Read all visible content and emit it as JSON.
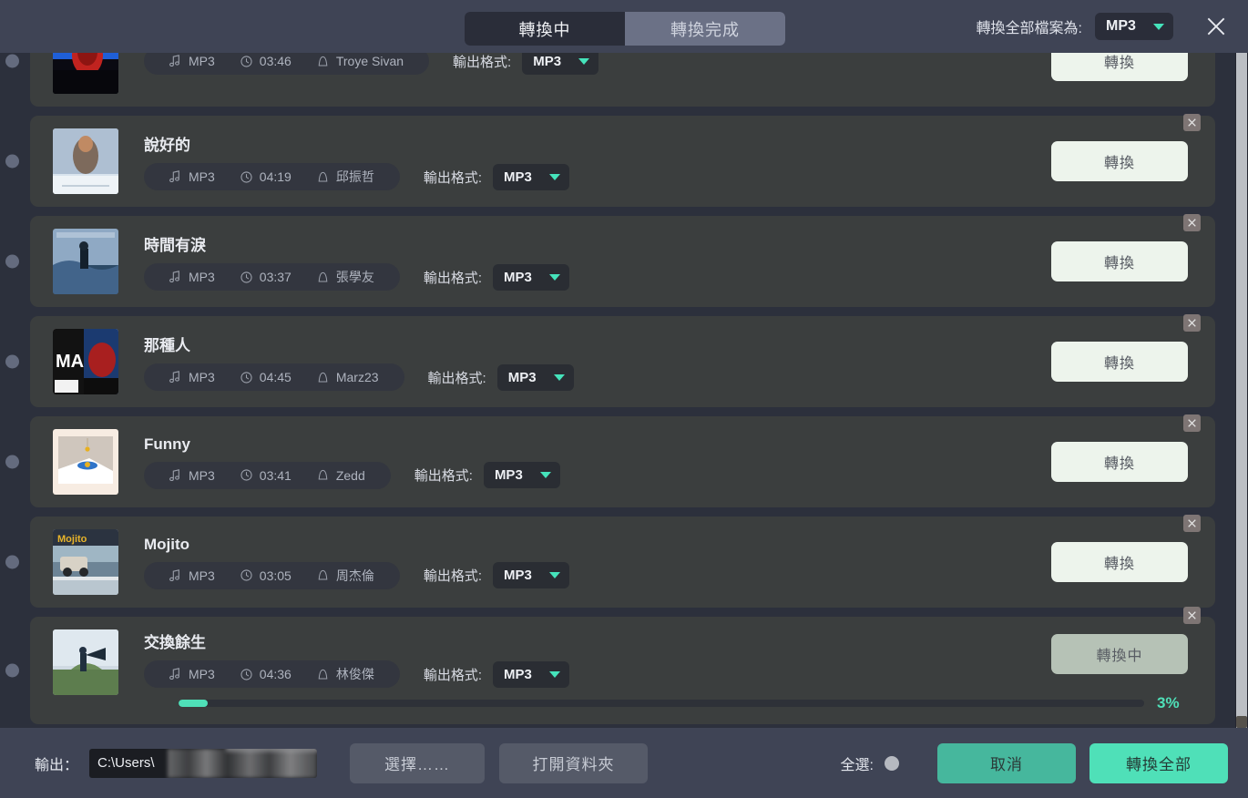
{
  "header": {
    "tabs": [
      {
        "label": "轉換中",
        "active": true
      },
      {
        "label": "轉換完成",
        "active": false
      }
    ],
    "convert_all_label": "轉換全部檔案為:",
    "convert_all_format": "MP3",
    "close_icon": "close-icon"
  },
  "list": {
    "format_label": "輸出格式:",
    "convert_label": "轉換",
    "converting_label": "轉換中",
    "items": [
      {
        "title": "",
        "codec": "MP3",
        "duration": "03:46",
        "artist": "Troye Sivan",
        "output_format": "MP3",
        "button_label": "轉換",
        "state": "idle",
        "partial": true
      },
      {
        "title": "說好的",
        "codec": "MP3",
        "duration": "04:19",
        "artist": "邱振哲",
        "output_format": "MP3",
        "button_label": "轉換",
        "state": "idle"
      },
      {
        "title": "時間有淚",
        "codec": "MP3",
        "duration": "03:37",
        "artist": "張學友",
        "output_format": "MP3",
        "button_label": "轉換",
        "state": "idle"
      },
      {
        "title": "那種人",
        "codec": "MP3",
        "duration": "04:45",
        "artist": "Marz23",
        "output_format": "MP3",
        "button_label": "轉換",
        "state": "idle"
      },
      {
        "title": "Funny",
        "codec": "MP3",
        "duration": "03:41",
        "artist": "Zedd",
        "output_format": "MP3",
        "button_label": "轉換",
        "state": "idle"
      },
      {
        "title": "Mojito",
        "codec": "MP3",
        "duration": "03:05",
        "artist": "周杰倫",
        "output_format": "MP3",
        "button_label": "轉換",
        "state": "idle"
      },
      {
        "title": "交換餘生",
        "codec": "MP3",
        "duration": "04:36",
        "artist": "林俊傑",
        "output_format": "MP3",
        "button_label": "轉換中",
        "state": "converting",
        "progress_percent": 3,
        "progress_label": "3%"
      }
    ]
  },
  "footer": {
    "output_label": "輸出：",
    "output_path": "C:\\Users\\",
    "choose_label": "選擇……",
    "open_folder_label": "打開資料夾",
    "select_all_label": "全選:",
    "cancel_label": "取消",
    "convert_all_label": "轉換全部"
  },
  "colors": {
    "accent_teal": "#4fe0b8",
    "accent_teal_dark": "#46b79d",
    "header_bg": "#3f4455",
    "row_bg": "#3b3e3e",
    "page_bg": "#2c303c"
  }
}
